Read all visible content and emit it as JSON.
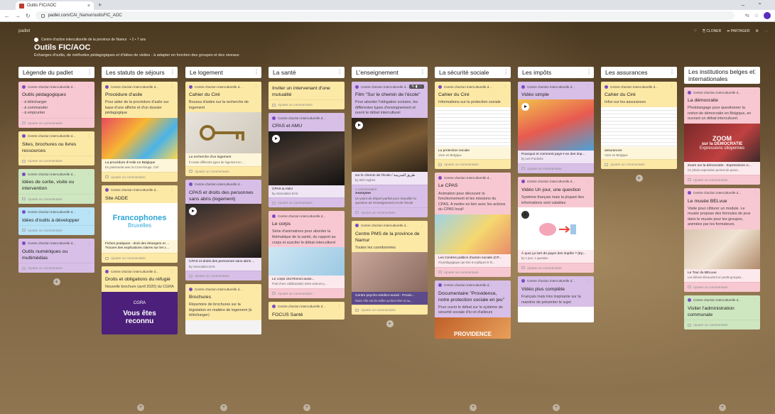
{
  "browser": {
    "tab_title": "Outils FIC/AOC",
    "tab_close": "×",
    "new_tab": "+",
    "url": "padlet.com/CAI_Namur/outilsFIC_AOC",
    "window_controls": "–  ⌃"
  },
  "padlet": {
    "brand": "padlet",
    "author": "Centre d'action interculturelle de la province de Namur",
    "author_meta": "• 2 • 7 ans",
    "title": "Outils FIC/AOC",
    "subtitle": "Echanges d'outils, de méthodes pédagogiques et d'idées de visites - à adapter en fonction des groupes et des niveaux",
    "actions": {
      "heart": "♡",
      "remix": "⎘ CLONER",
      "share": "➦ PARTAGER",
      "more": "⋯"
    }
  },
  "common": {
    "author_short": "Centre d'action interculturelle d...",
    "comment": "Ajouter un commentaire",
    "kebab": "⋮",
    "plus": "+",
    "dots": "⋮"
  },
  "columns": [
    {
      "title": "Légende du padlet"
    },
    {
      "title": "Les statuts de séjours"
    },
    {
      "title": "Le logement"
    },
    {
      "title": "La santé"
    },
    {
      "title": "L'enseignement"
    },
    {
      "title": "La sécurité sociale"
    },
    {
      "title": "Les impôts"
    },
    {
      "title": "Les assurances"
    },
    {
      "title": "Les institutions belges et internationales"
    }
  ],
  "col1": {
    "c1_title": "Outils pédagogiques",
    "c1_l1": "- à télécharger",
    "c1_l2": "- à commander",
    "c1_l3": "- à emprunter",
    "c2_title": "Sites, brochures ou livres ressources",
    "c3_title": "Idées de sortie, visite ou intervention",
    "c4_title": "Idées d'outils à développer",
    "c5_title": "Outils numériques ou multimédias"
  },
  "col2": {
    "c1_title": "Procédure d'asile",
    "c1_body": "Pour aider de la procédure d'asile sur base d'une affiche et d'un dossier pédagogique",
    "c1_caption": "La procédure d'Asile en Belgique",
    "c1_caption_sub": "En partenariat avec la Croix-Rouge, Ciré",
    "c2_title": "Site ADDE",
    "c2_logo_line1": "Francophones",
    "c2_logo_line2": "Bruxelles",
    "c2_caption": "Fiches pratiques - droit des étrangers et ... Trouver des explications claires sur les c...",
    "c3_title": "Droits et obligations du réfugié",
    "c3_body": "Nouvelle brochure (avril 2020) du CGRA",
    "c3_img_logo": "CGRA",
    "c3_img_line1": "Vous êtes",
    "c3_img_line2": "reconnu"
  },
  "col3": {
    "c1_title": "Cahier du Ciré",
    "c1_body": "Boussa d'aides sur la recherche de logement",
    "c1_caption": "La recherche d'un logement",
    "c1_caption_sub": "Il existe différents types de logement en ...",
    "c2_title": "CPAS et droits des personnes sans abris (logement)",
    "c2_caption": "CPAS et droits des personnes sans abris ...",
    "c2_caption_sub": "by Association DAS",
    "c3_title": "Brochures",
    "c3_body": "Répertoire de brochures sur la législation en matière de logement (à télécharger)"
  },
  "col4": {
    "c1_title": "Inviter un intervenant d'une mutualité",
    "c2_title": "CPAS et AMU",
    "c2_caption": "CPAS & AMU",
    "c2_caption_sub": "by Association DAS",
    "c3_title": "Le corps",
    "c3_body": "Série d'animations pour aborder la thématique de la santé, du rapport au corps et susciter le débat interculturel",
    "c3_caption": "Le corps citoYEnnet aussi...",
    "c3_caption_sub": "Fruit d'une collaboration entre acteurs p...",
    "c4_title": "FOCUS Santé"
  },
  "col5": {
    "c1_title": "Film \"Sur le chemin de l'école\"",
    "c1_body": "Pour aborder l'obligation scolaire, les différentes types d'enseignement et ouvrir le débat interculturel",
    "c1_caption": "sur le chemin de l'école / طريق المدرسة",
    "c1_caption_sub": "by Stef Anghen",
    "c1_comment_count": "1 commentaire",
    "c1_comment_author": "Anonyme",
    "c1_comment_text": "Un point de départ parfait pour travailler la question de l'enseignement et de l'école",
    "c2_title": "Centre PMS de la province de Namur",
    "c2_body": "Toutes les coordonnées",
    "c2_caption": "Centre psycho-médico-social - Provin...",
    "c2_caption_sub": "Notre rôle est de veiller au bien-être et au..."
  },
  "col6": {
    "c1_title": "Cahier du Ciré",
    "c1_body": "Informations sur la protection sociale",
    "c1_caption": "La protection sociale",
    "c1_caption_sub": "Vivre en Belgique",
    "c2_title": "Le CPAS",
    "c2_body": "Animation pour découvrir le fonctionnement et les missions du CPAS. A mettre en lien avec les actions du CPAS local!",
    "c2_caption": "Les Centres publics d'action sociale (CP...",
    "c2_caption_sub": "Kit pédagogique qui vise à expliquer le fo...",
    "c3_title": "Documentaire \"Providence, notre protection sociale en jeu\"",
    "c3_body": "Pour ouvrir le débat sur le système de sécurité sociale d'ici et d'ailleurs",
    "c3_img_text": "PROVIDENCE"
  },
  "col7": {
    "c1_title": "Vidéo simple",
    "c1_caption": "Pourquoi et comment paye-t-on des imp...",
    "c1_caption_sub": "by Les P'animés",
    "c2_title": "Vidéo Un jour, une question",
    "c2_body": "Système français mais la plupart des informations sont valables",
    "c2_caption": "À quoi ça sert de payer des impôts ? (Ep...",
    "c2_caption_sub": "by 1 jour, 1 question",
    "c3_title": "Vidéo plus complète",
    "c3_body": "Français mais très inspirante sur la manière de présenter le sujet"
  },
  "col8": {
    "c1_title": "Cahier du Ciré",
    "c1_body": "Infos sur les assurances",
    "c1_caption": "assurances",
    "c1_caption_sub": "Vivre en Belgique"
  },
  "col9": {
    "c1_title": "La démocratie",
    "c1_body": "Photolangage pour questionner la notion de démocratie en Belgique, en ouvrant un débat interculturel.",
    "c1_img_line1": "ZOOM",
    "c1_img_line2": "sur la DÉMOCRATIE",
    "c1_img_line3": "Expressions citoyennes",
    "c1_caption": "Zoom sur la démocratie - Expressions ci...",
    "c1_caption_sub": "Ce photo-expression permet de poser...",
    "c2_title": "Le musée BELvue",
    "c2_body": "Visite pour clôturer un module. Le musée propose des formules de jeux dans le musée pour les groupes, animées par les formateurs.",
    "c2_caption": "Le Tour du BELvue",
    "c2_caption_sub": "Les élèves découvrent en petits groupes...",
    "c3_title": "Visiter l'administration communale"
  }
}
